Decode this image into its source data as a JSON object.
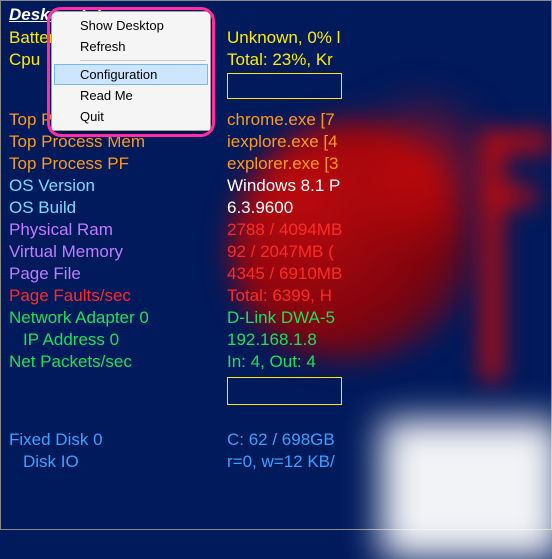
{
  "title": "Desktop Info",
  "rows": {
    "battery": {
      "label": "Battery",
      "value": "Unknown, 0% l",
      "labelColor": "c-yellow",
      "valueColor": "c-yellow"
    },
    "cpu": {
      "label": "Cpu",
      "value": "Total: 23%, Kr",
      "labelColor": "c-yellow",
      "valueColor": "c-yellow"
    },
    "top_cpu": {
      "label": "Top Process Cpu",
      "value": "chrome.exe [7",
      "labelColor": "c-orange",
      "valueColor": "c-orange"
    },
    "top_mem": {
      "label": "Top Process Mem",
      "value": "iexplore.exe [4",
      "labelColor": "c-orange",
      "valueColor": "c-orange"
    },
    "top_pf": {
      "label": "Top Process PF",
      "value": "explorer.exe [3",
      "labelColor": "c-orange",
      "valueColor": "c-orange"
    },
    "os_version": {
      "label": "OS Version",
      "value": "Windows 8.1 P",
      "labelColor": "c-cyan",
      "valueColor": "c-white"
    },
    "os_build": {
      "label": "OS Build",
      "value": "6.3.9600",
      "labelColor": "c-cyan",
      "valueColor": "c-white"
    },
    "phys_ram": {
      "label": "Physical Ram",
      "value": "2788 / 4094MB",
      "labelColor": "c-violet",
      "valueColor": "c-red"
    },
    "virt_mem": {
      "label": "Virtual Memory",
      "value": "92 / 2047MB (",
      "labelColor": "c-violet",
      "valueColor": "c-red"
    },
    "page_file": {
      "label": "Page File",
      "value": "4345 / 6910MB",
      "labelColor": "c-violet",
      "valueColor": "c-red"
    },
    "page_faults": {
      "label": "Page Faults/sec",
      "value": "Total: 6399, H",
      "labelColor": "c-red",
      "valueColor": "c-red"
    },
    "net_adapter": {
      "label": "Network Adapter 0",
      "value": "D-Link DWA-5",
      "labelColor": "c-green",
      "valueColor": "c-green"
    },
    "ip_addr": {
      "label": "IP Address 0",
      "value": "192.168.1.8",
      "labelColor": "c-green",
      "valueColor": "c-green"
    },
    "net_packets": {
      "label": "Net Packets/sec",
      "value": "In: 4, Out: 4",
      "labelColor": "c-green",
      "valueColor": "c-green"
    },
    "fixed_disk": {
      "label": "Fixed Disk 0",
      "value": "C: 62 / 698GB",
      "labelColor": "c-blue",
      "valueColor": "c-blue"
    },
    "disk_io": {
      "label": "Disk IO",
      "value": "r=0, w=12 KB/",
      "labelColor": "c-blue",
      "valueColor": "c-blue"
    }
  },
  "context_menu": {
    "items": [
      {
        "label": "Show Desktop",
        "highlighted": false
      },
      {
        "label": "Refresh",
        "highlighted": false
      },
      {
        "label": "Configuration",
        "highlighted": true
      },
      {
        "label": "Read Me",
        "highlighted": false
      },
      {
        "label": "Quit",
        "highlighted": false
      }
    ]
  }
}
